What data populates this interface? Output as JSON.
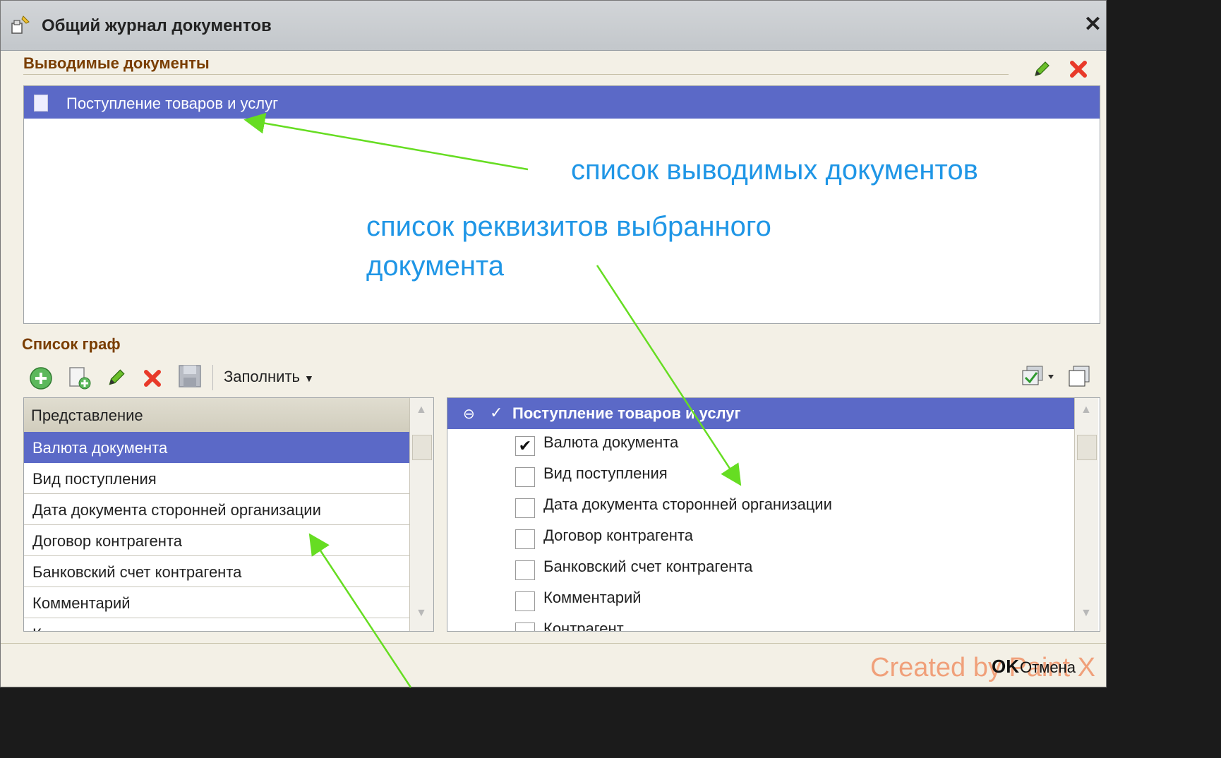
{
  "window": {
    "title": "Общий журнал документов",
    "close_label": "✕"
  },
  "documents_section": {
    "header": "Выводимые документы",
    "items": [
      {
        "label": "Поступление товаров и услуг",
        "selected": true
      }
    ]
  },
  "columns_section": {
    "header": "Список граф",
    "fill_button": "Заполнить",
    "table": {
      "column_header": "Представление",
      "rows": [
        {
          "label": "Валюта документа",
          "selected": true
        },
        {
          "label": "Вид поступления"
        },
        {
          "label": "Дата документа сторонней организации"
        },
        {
          "label": "Договор  контрагента"
        },
        {
          "label": "Банковский счет контрагента"
        },
        {
          "label": "Комментарий"
        },
        {
          "label": "Контрагент"
        }
      ]
    }
  },
  "attributes_tree": {
    "root_label": "Поступление товаров и услуг",
    "items": [
      {
        "label": "Валюта документа",
        "checked": true
      },
      {
        "label": "Вид поступления",
        "checked": false
      },
      {
        "label": "Дата документа сторонней организации",
        "checked": false
      },
      {
        "label": "Договор  контрагента",
        "checked": false
      },
      {
        "label": "Банковский счет контрагента",
        "checked": false
      },
      {
        "label": "Комментарий",
        "checked": false
      },
      {
        "label": "Контрагент",
        "checked": false
      }
    ]
  },
  "annotations": {
    "doc_list": "список выводимых документов",
    "attr_list_line1": "список реквизитов выбранного",
    "attr_list_line2": "документа"
  },
  "footer": {
    "ok_label": "OK",
    "cancel_label": "Отмена",
    "watermark": "Created by Paint X"
  },
  "colors": {
    "selection": "#5b69c7",
    "header_text": "#7a3e00",
    "annotation_text": "#1f96e6",
    "arrow": "#66dd22",
    "delete_red": "#e83a2a"
  }
}
